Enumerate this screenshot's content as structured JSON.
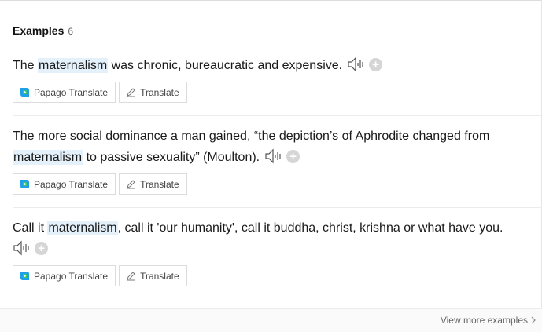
{
  "header": {
    "title": "Examples",
    "count": "6"
  },
  "examples": [
    {
      "before": "The ",
      "highlight": "maternalism",
      "after": " was chronic, bureaucratic and expensive."
    },
    {
      "before": "The more social dominance a man gained, “the depiction’s of Aphrodite changed from ",
      "highlight": "maternalism",
      "after": " to passive sexuality” (Moulton)."
    },
    {
      "before": "Call it ",
      "highlight": "maternalism",
      "after": ", call it 'our humanity', call it buddha, christ, krishna or what have you."
    }
  ],
  "buttons": {
    "papago": "Papago Translate",
    "translate": "Translate",
    "add": "+"
  },
  "footer": {
    "more": "View more examples"
  },
  "colors": {
    "highlight": "#e4f1fb",
    "papago_blue": "#1fa0e6",
    "papago_green": "#3cc36b"
  },
  "icons": [
    "speaker-icon",
    "plus-icon",
    "papago-icon",
    "pencil-icon",
    "chevron-right-icon"
  ]
}
